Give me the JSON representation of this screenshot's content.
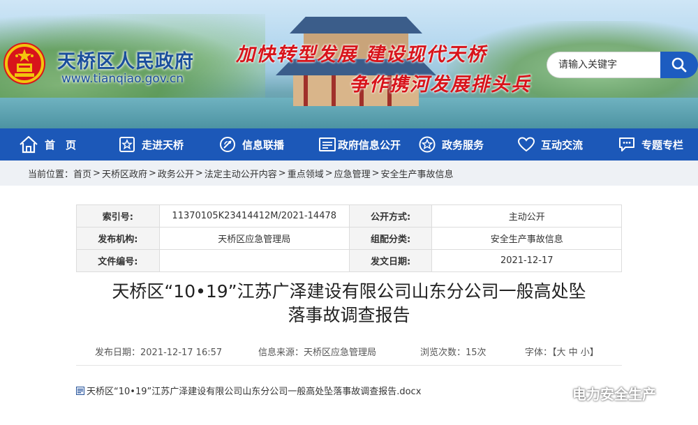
{
  "header": {
    "site_name": "天桥区人民政府",
    "site_url": "www.tianqiao.gov.cn",
    "slogan_line1": "加快转型发展 建设现代天桥",
    "slogan_line2": "争作携河发展排头兵",
    "search_placeholder": "请输入关键字"
  },
  "nav": {
    "items": [
      {
        "label": "首　页",
        "icon": "home-icon"
      },
      {
        "label": "走进天桥",
        "icon": "star-frame-icon"
      },
      {
        "label": "信息联播",
        "icon": "broadcast-icon"
      },
      {
        "label": "政府信息公开",
        "icon": "document-list-icon"
      },
      {
        "label": "政务服务",
        "icon": "star-circle-icon"
      },
      {
        "label": "互动交流",
        "icon": "heart-icon"
      },
      {
        "label": "专题专栏",
        "icon": "chat-icon"
      }
    ]
  },
  "breadcrumb": {
    "prefix": "当前位置：",
    "items": [
      "首页",
      "天桥区政府",
      "政务公开",
      "法定主动公开内容",
      "重点领域",
      "应急管理",
      "安全生产事故信息"
    ]
  },
  "info": {
    "index_label": "索引号:",
    "index_value": "11370105K23414412M/2021-14478",
    "method_label": "公开方式:",
    "method_value": "主动公开",
    "publisher_label": "发布机构:",
    "publisher_value": "天桥区应急管理局",
    "category_label": "组配分类:",
    "category_value": "安全生产事故信息",
    "docno_label": "文件编号:",
    "docno_value": "",
    "date_label": "发文日期:",
    "date_value": "2021-12-17"
  },
  "article": {
    "title_line1": "天桥区“10•19”江苏广泽建设有限公司山东分公司一般高处坠",
    "title_line2": "落事故调查报告",
    "publish_date": "发布日期：2021-12-17 16:57",
    "source": "信息来源：天桥区应急管理局",
    "views": "浏览次数：15次",
    "font_size": "字体：【大 中 小】",
    "attachment": "天桥区“10•19”江苏广泽建设有限公司山东分公司一般高处坠落事故调查报告.docx"
  },
  "watermark": {
    "text": "电力安全生产"
  },
  "colors": {
    "nav_bg": "#1c58b8",
    "site_name": "#1b4f9c",
    "slogan": "#d8141b",
    "breadcrumb_bg": "#eef1f5"
  }
}
